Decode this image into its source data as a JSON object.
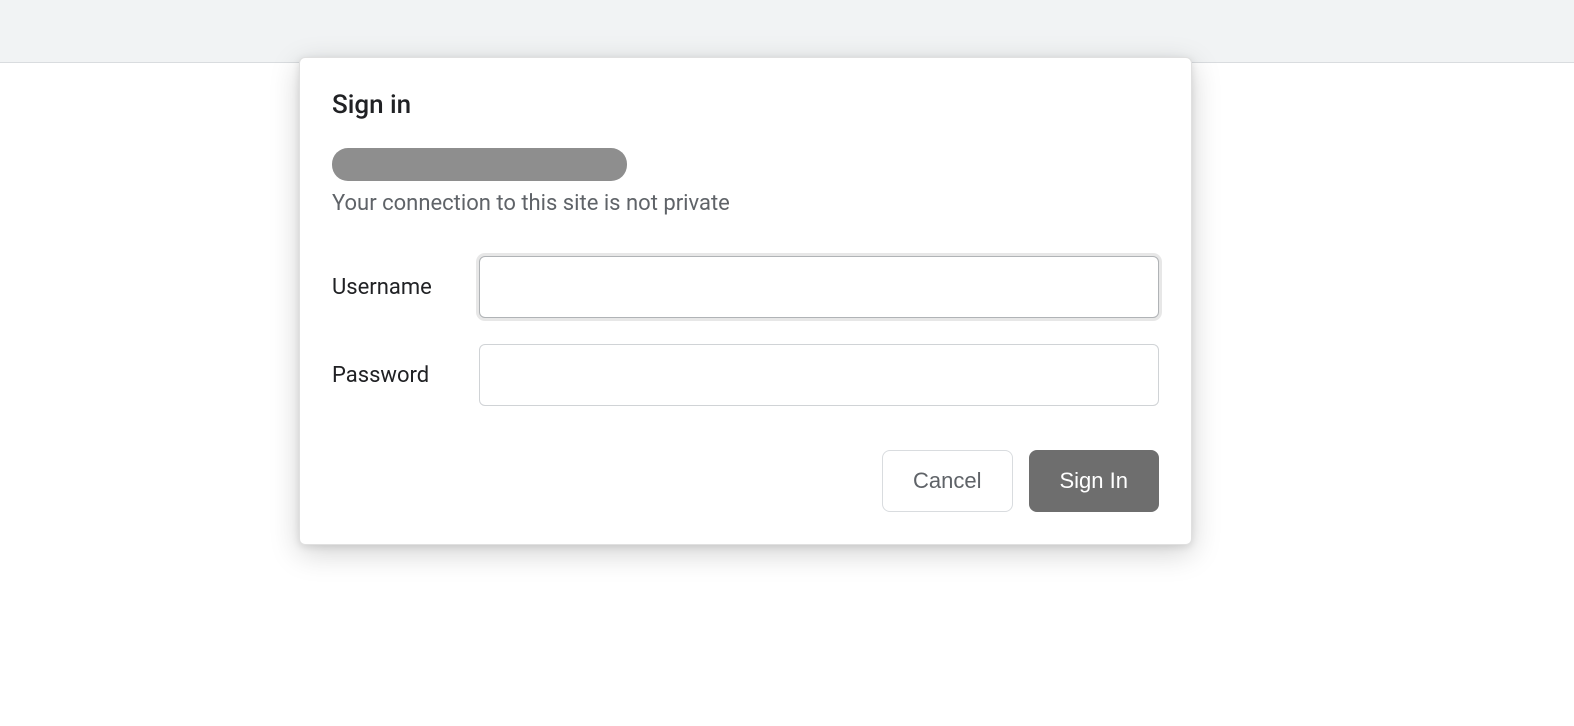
{
  "dialog": {
    "title": "Sign in",
    "warning": "Your connection to this site is not private",
    "fields": {
      "username_label": "Username",
      "username_value": "",
      "password_label": "Password",
      "password_value": ""
    },
    "buttons": {
      "cancel": "Cancel",
      "signin": "Sign In"
    }
  }
}
